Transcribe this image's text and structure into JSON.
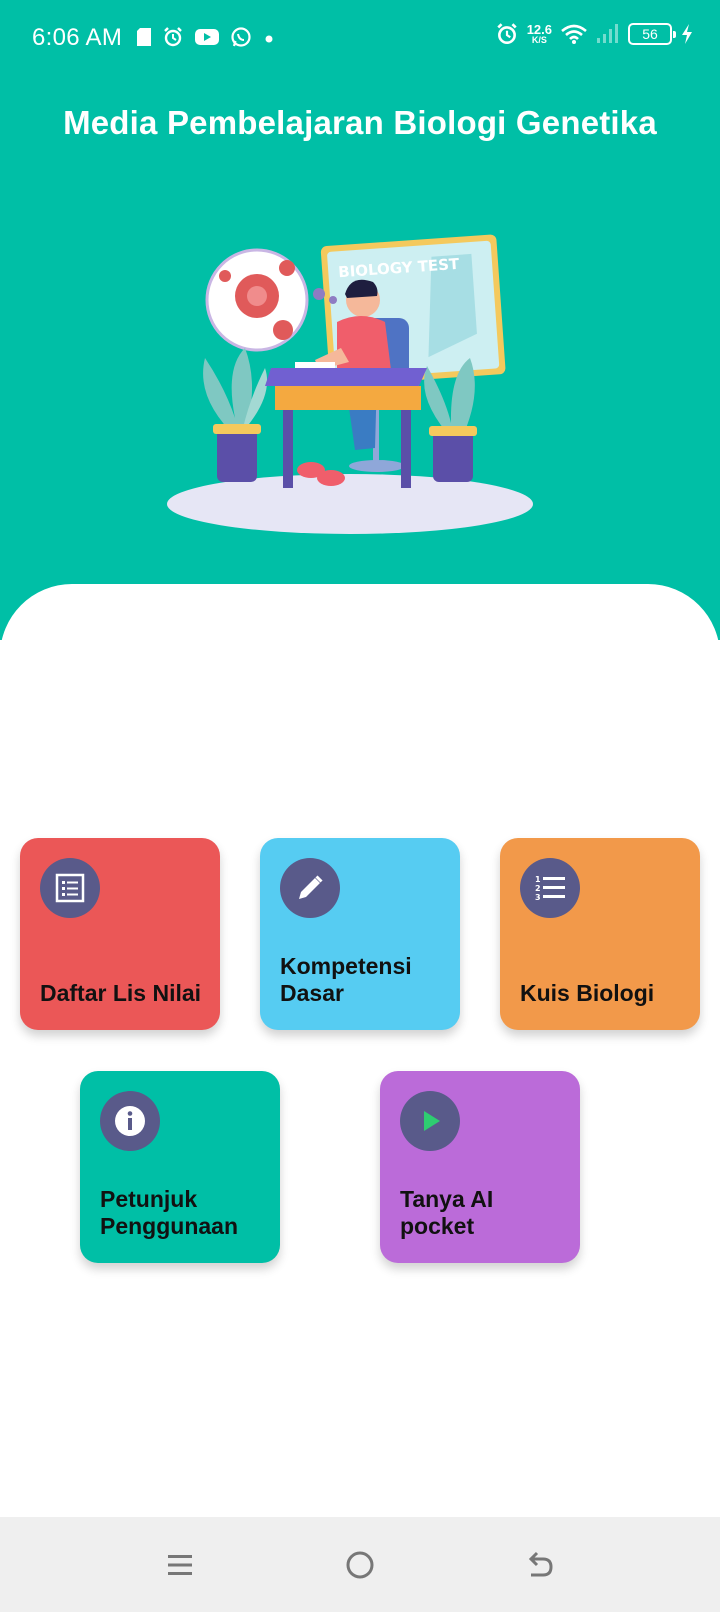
{
  "status_bar": {
    "time": "6:06 AM",
    "net_speed_value": "12.6",
    "net_speed_unit": "K/S",
    "battery_level": "56",
    "left_icons": [
      "sd-card-icon",
      "alarm-icon",
      "youtube-icon",
      "whatsapp-icon",
      "dot-icon"
    ],
    "right_icons": [
      "alarm-icon",
      "wifi-icon",
      "signal-icon",
      "battery-icon",
      "charging-icon"
    ]
  },
  "header": {
    "title": "Media Pembelajaran Biologi Genetika",
    "illustration_text": "BIOLOGY TEST"
  },
  "menu": {
    "tiles": [
      {
        "label": "Daftar Lis Nilai",
        "icon": "list-icon",
        "color": "#EB5757"
      },
      {
        "label": "Kompetensi Dasar",
        "icon": "pencil-icon",
        "color": "#56CCF2"
      },
      {
        "label": "Kuis Biologi",
        "icon": "numbered-list-icon",
        "color": "#F2994A"
      },
      {
        "label": "Petunjuk Penggunaan",
        "icon": "info-icon",
        "color": "#00BFA6"
      },
      {
        "label": "Tanya AI pocket",
        "icon": "play-icon",
        "color": "#BB6BD9"
      }
    ]
  },
  "nav_bar": {
    "icons": [
      "menu-icon",
      "home-icon",
      "back-icon"
    ]
  },
  "colors": {
    "primary": "#00BFA6",
    "icon_circle": "#595A8A",
    "play_green": "#2ECC71"
  }
}
